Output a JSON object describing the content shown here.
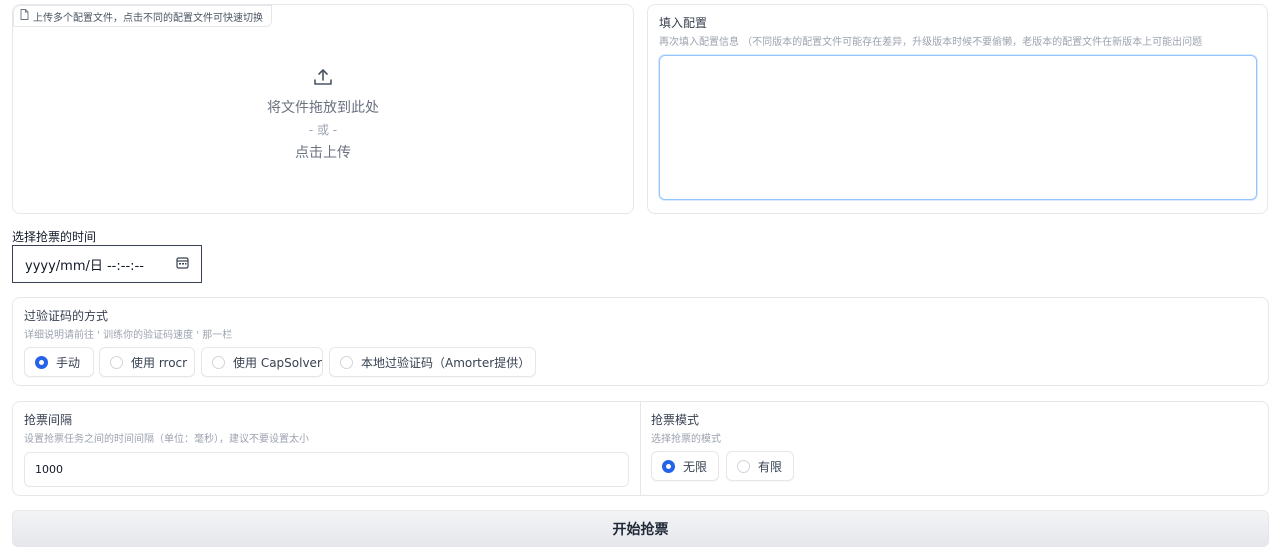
{
  "upload": {
    "tag_label": "上传多个配置文件，点击不同的配置文件可快速切换",
    "drop_text": "将文件拖放到此处",
    "or_text": "- 或 -",
    "click_text": "点击上传",
    "tag_icon": "file-icon",
    "upload_icon": "upload-icon"
  },
  "config": {
    "label": "填入配置",
    "info": "再次填入配置信息 （不同版本的配置文件可能存在差异，升级版本时候不要偷懒，老版本的配置文件在新版本上可能出问题",
    "value": ""
  },
  "time": {
    "label": "选择抢票的时间",
    "placeholder": "yyyy/mm/日 --:--:--",
    "icon": "calendar-icon"
  },
  "captcha": {
    "label": "过验证码的方式",
    "info": "详细说明请前往 ' 训练你的验证码速度 ' 那一栏",
    "options": [
      "手动",
      "使用 rrocr",
      "使用 CapSolver",
      "本地过验证码（Amorter提供）"
    ],
    "selected": "手动"
  },
  "interval": {
    "label": "抢票间隔",
    "info": "设置抢票任务之间的时间间隔（单位：毫秒），建议不要设置太小",
    "value": "1000"
  },
  "mode": {
    "label": "抢票模式",
    "info": "选择抢票的模式",
    "options": [
      "无限",
      "有限"
    ],
    "selected": "无限"
  },
  "start_button": "开始抢票",
  "colors": {
    "accent": "#2563eb",
    "focus_border": "#93c5fd",
    "button_bg": "#e5e7eb"
  }
}
